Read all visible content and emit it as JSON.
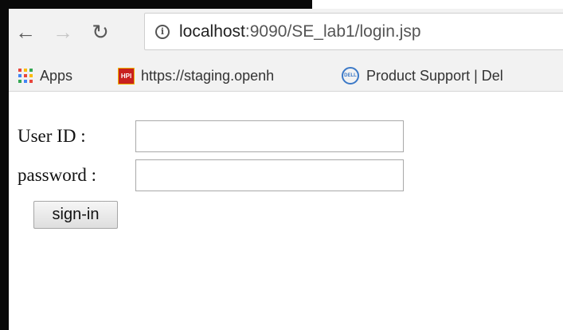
{
  "browser": {
    "address": {
      "host": "localhost",
      "rest": ":9090/SE_lab1/login.jsp"
    },
    "nav": {
      "back_icon": "back-arrow-icon",
      "forward_icon": "forward-arrow-icon",
      "reload_icon": "reload-icon"
    },
    "bookmarks": [
      {
        "label": "Apps",
        "icon": "apps-grid-icon"
      },
      {
        "label": "https://staging.openh",
        "icon": "hpi-favicon",
        "icon_text": "HPI"
      },
      {
        "label": "Product Support | Del",
        "icon": "dell-favicon",
        "icon_text": "DELL"
      }
    ]
  },
  "form": {
    "user_id_label": "User ID :",
    "user_id_value": "",
    "password_label": "password :",
    "password_value": "",
    "signin_label": "sign-in"
  },
  "colors": {
    "apps_grid": [
      "#e8453c",
      "#fbbc05",
      "#34a853",
      "#4285f4",
      "#e8453c",
      "#fbbc05",
      "#34a853",
      "#4285f4",
      "#e8453c"
    ],
    "hpi_favicon": "#c8211f",
    "dell_favicon": "#3c79c7"
  }
}
